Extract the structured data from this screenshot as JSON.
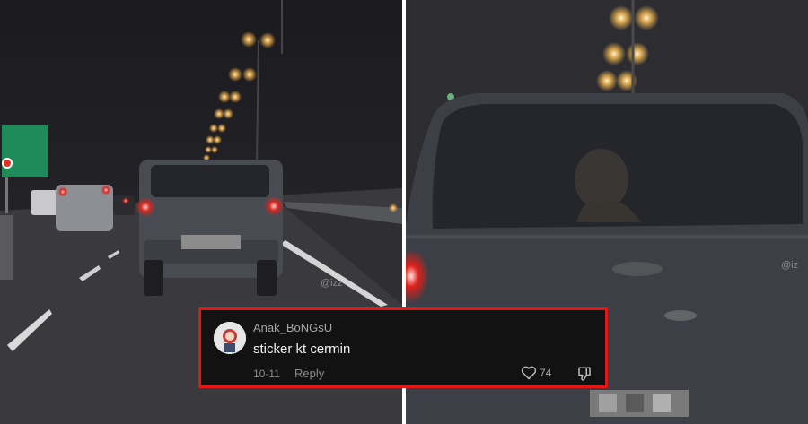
{
  "left_photo": {
    "watermark": "@izz"
  },
  "right_photo": {
    "watermark": "@iz"
  },
  "comment": {
    "username": "Anak_BoNGsU",
    "text": "sticker kt cermin",
    "date": "10-11",
    "reply_label": "Reply",
    "like_count": "74",
    "border_color": "#e01818",
    "icons": [
      "avatar",
      "heart-icon",
      "thumbs-down-icon"
    ]
  }
}
